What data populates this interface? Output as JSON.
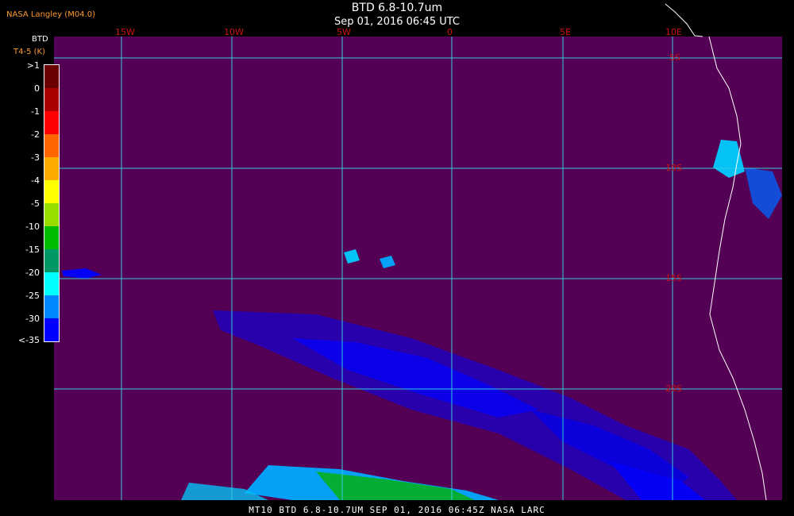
{
  "credit": "NASA Langley (M04.0)",
  "title": "BTD 6.8-10.7um",
  "datetime": "Sep 01, 2016 06:45 UTC",
  "legend": {
    "title": "BTD",
    "subtitle": "T4-5 (K)",
    "ticks": [
      ">1",
      "0",
      "-1",
      "-2",
      "-3",
      "-4",
      "-5",
      "-10",
      "-15",
      "-20",
      "-25",
      "-30",
      "<-35"
    ],
    "colors": [
      "#6b0000",
      "#aa0000",
      "#ff0000",
      "#ff6600",
      "#ffaa00",
      "#ffff00",
      "#99dd00",
      "#00bb00",
      "#009966",
      "#00ffff",
      "#0088ff",
      "#0000ff",
      "#540054"
    ]
  },
  "lon_labels": [
    "15W",
    "10W",
    "5W",
    "0",
    "5E",
    "10E"
  ],
  "lat_labels": [
    "5S",
    "10S",
    "15S",
    "20S"
  ],
  "footer": "MT10  BTD 6.8-10.7UM   SEP 01, 2016 06:45Z   NASA LARC"
}
